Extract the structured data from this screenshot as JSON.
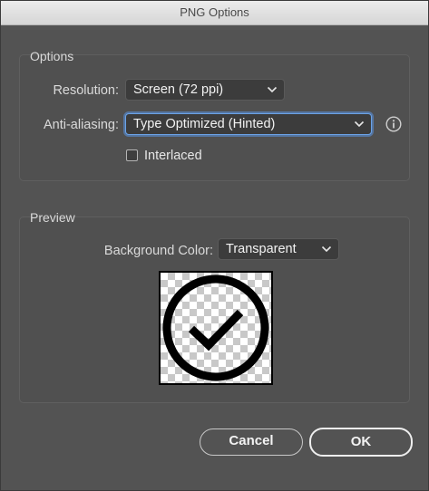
{
  "window": {
    "title": "PNG Options"
  },
  "options_group": {
    "title": "Options",
    "resolution": {
      "label": "Resolution:",
      "value": "Screen (72 ppi)"
    },
    "anti_aliasing": {
      "label": "Anti-aliasing:",
      "value": "Type Optimized (Hinted)"
    },
    "interlaced": {
      "label": "Interlaced",
      "checked": false
    }
  },
  "preview_group": {
    "title": "Preview",
    "background_color": {
      "label": "Background Color:",
      "value": "Transparent"
    },
    "preview_icon": "checkmark-circle-icon"
  },
  "buttons": {
    "cancel_label": "Cancel",
    "ok_label": "OK"
  },
  "colors": {
    "dialog_bg": "#535353",
    "focus_ring": "#6ba2e6",
    "text": "#dadada"
  }
}
